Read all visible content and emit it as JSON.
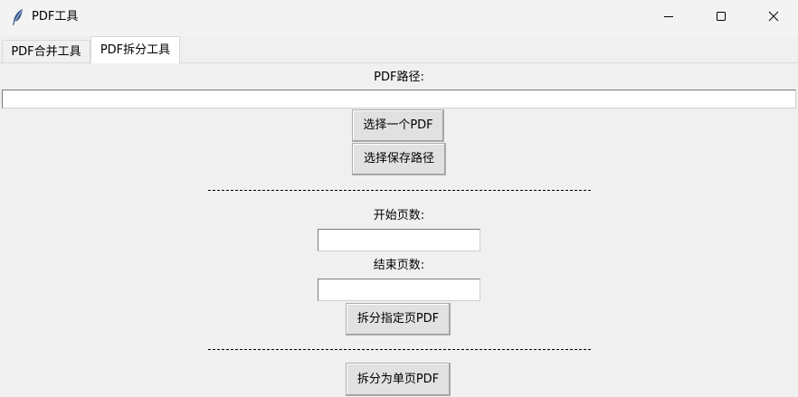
{
  "window": {
    "title": "PDF工具",
    "icon": "feather-icon",
    "controls": {
      "minimize": "minimize-icon",
      "maximize": "maximize-icon",
      "close": "close-icon"
    }
  },
  "tabs": [
    {
      "label": "PDF合并工具",
      "selected": false
    },
    {
      "label": "PDF拆分工具",
      "selected": true
    }
  ],
  "split": {
    "path_label": "PDF路径:",
    "path_value": "",
    "choose_pdf_button": "选择一个PDF",
    "choose_save_button": "选择保存路径",
    "separator_1": "-----------------------------------------------------------------------------------",
    "start_page_label": "开始页数:",
    "start_page_value": "",
    "end_page_label": "结束页数:",
    "end_page_value": "",
    "split_range_button": "拆分指定页PDF",
    "separator_2": "-----------------------------------------------------------------------------------",
    "split_single_button": "拆分为单页PDF"
  }
}
